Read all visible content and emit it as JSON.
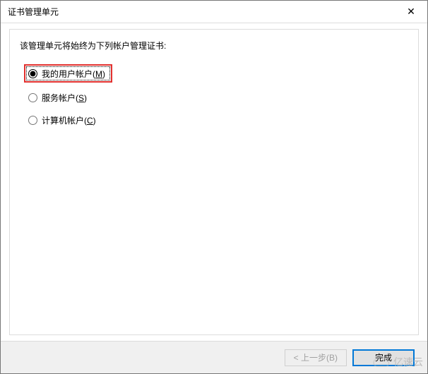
{
  "window": {
    "title": "证书管理单元",
    "close_glyph": "✕"
  },
  "content": {
    "instruction": "该管理单元将始终为下列帐户管理证书:"
  },
  "options": {
    "my_user": {
      "label_prefix": "我的用户帐户(",
      "hotkey": "M",
      "label_suffix": ")",
      "selected": true,
      "highlighted": true
    },
    "service": {
      "label_prefix": "服务帐户(",
      "hotkey": "S",
      "label_suffix": ")",
      "selected": false,
      "highlighted": false
    },
    "computer": {
      "label_prefix": "计算机帐户(",
      "hotkey": "C",
      "label_suffix": ")",
      "selected": false,
      "highlighted": false
    }
  },
  "footer": {
    "back_label": "< 上一步(B)",
    "finish_label": "完成",
    "back_enabled": false
  },
  "watermark": {
    "text": "亿速云"
  }
}
